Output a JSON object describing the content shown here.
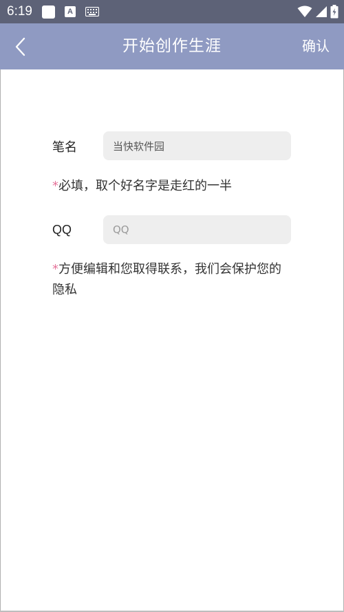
{
  "status_bar": {
    "time": "6:19"
  },
  "app_bar": {
    "title": "开始创作生涯",
    "confirm_label": "确认",
    "back_icon": "chevron-left-icon"
  },
  "form": {
    "pen_name": {
      "label": "笔名",
      "value": "当快软件园",
      "hint_star": "*",
      "hint": "必填，取个好名字是走红的一半"
    },
    "qq": {
      "label": "QQ",
      "placeholder": "QQ",
      "hint_star": "*",
      "hint": "方便编辑和您取得联系，我们会保护您的隐私"
    }
  },
  "colors": {
    "status_bar": "#5d6277",
    "app_bar": "#8f9ac2",
    "input_bg": "#eeeeee",
    "required_star": "#e5739a"
  }
}
